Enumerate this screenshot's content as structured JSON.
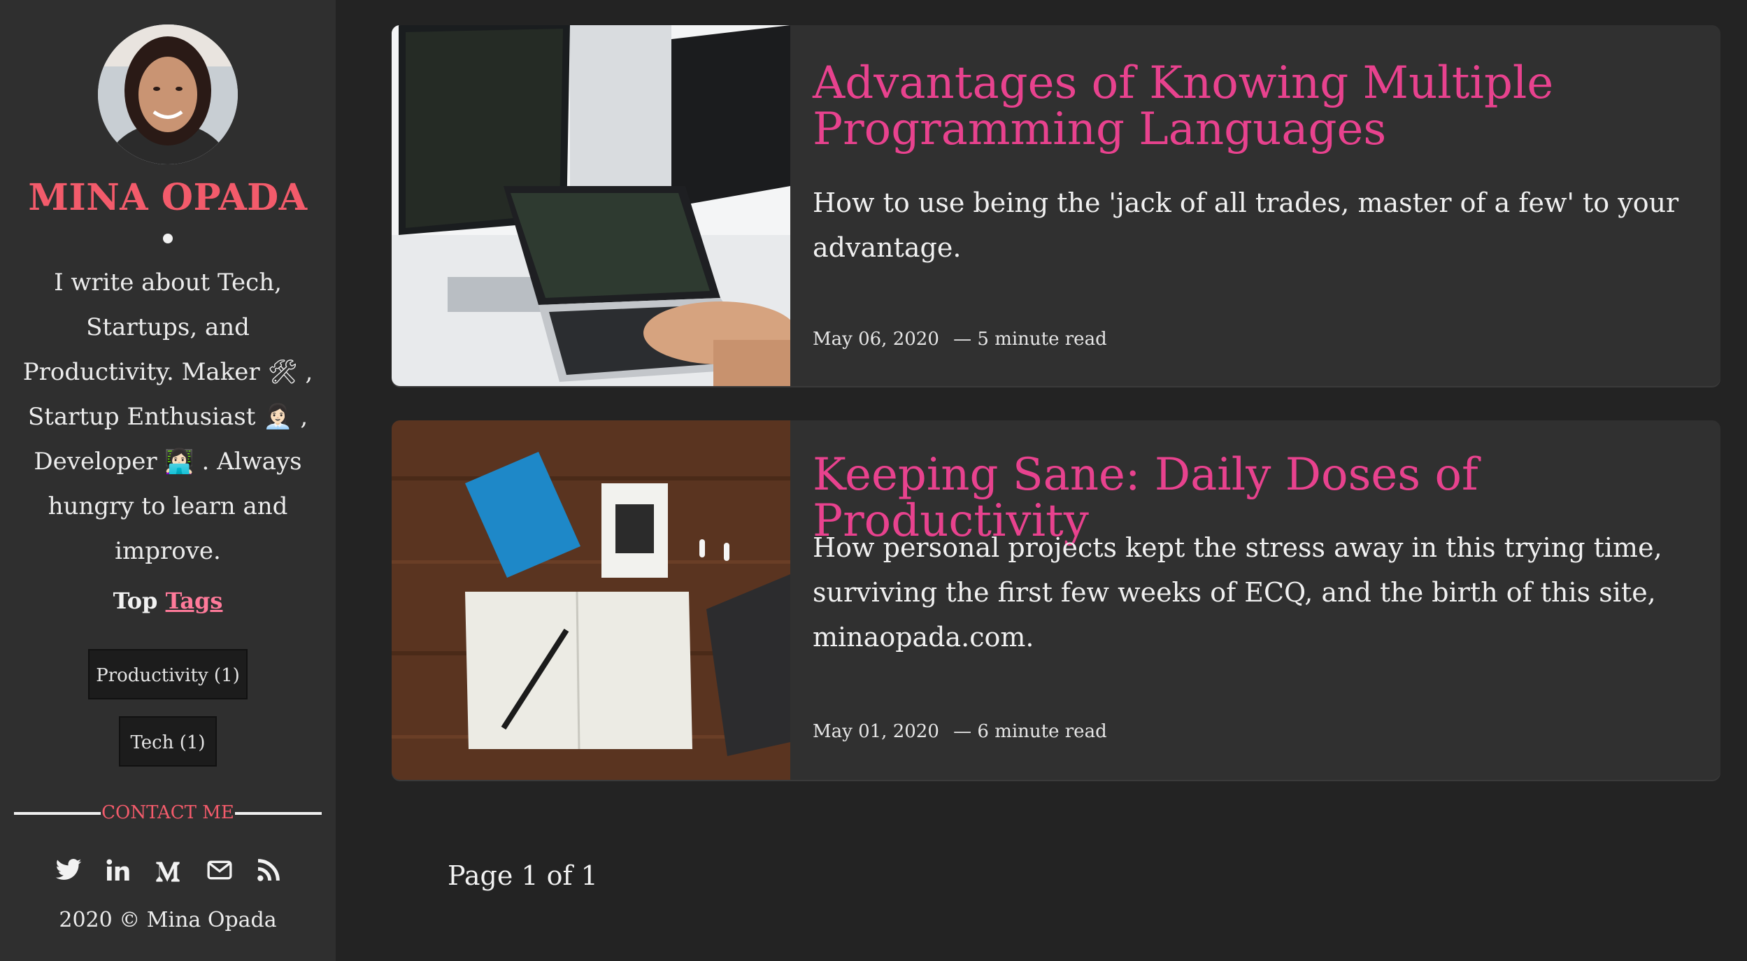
{
  "sidebar": {
    "site_name": "MINA OPADA",
    "bio": "I write about Tech, Startups, and Productivity. Maker 🛠 , Startup Enthusiast 👩🏻‍💼 , Developer 👩🏻‍💻 . Always hungry to learn and improve.",
    "top_tags_prefix": "Top",
    "top_tags_link": "Tags",
    "tags": [
      {
        "label": "Productivity (1)"
      },
      {
        "label": "Tech (1)"
      }
    ],
    "contact_label": "CONTACT ME",
    "social_icons": [
      "twitter-icon",
      "linkedin-icon",
      "medium-icon",
      "email-icon",
      "rss-icon"
    ],
    "copyright": "2020 © Mina Opada"
  },
  "posts": [
    {
      "title": "Advantages of Knowing Multiple Programming Languages",
      "description": "How to use being the 'jack of all trades, master of a few' to your advantage.",
      "date": "May 06, 2020",
      "separator": "—",
      "read_time": "5 minute read"
    },
    {
      "title": "Keeping Sane: Daily Doses of Productivity",
      "description": "How personal projects kept the stress away in this trying time, surviving the first few weeks of ECQ, and the birth of this site, minaopada.com.",
      "date": "May 01, 2020",
      "separator": "—",
      "read_time": "6 minute read"
    }
  ],
  "pagination": {
    "label": "Page 1 of 1"
  },
  "colors": {
    "background": "#232323",
    "sidebar": "#2f2f2f",
    "card": "#303030",
    "accent_name": "#f35b6b",
    "accent_title": "#e8428e"
  }
}
